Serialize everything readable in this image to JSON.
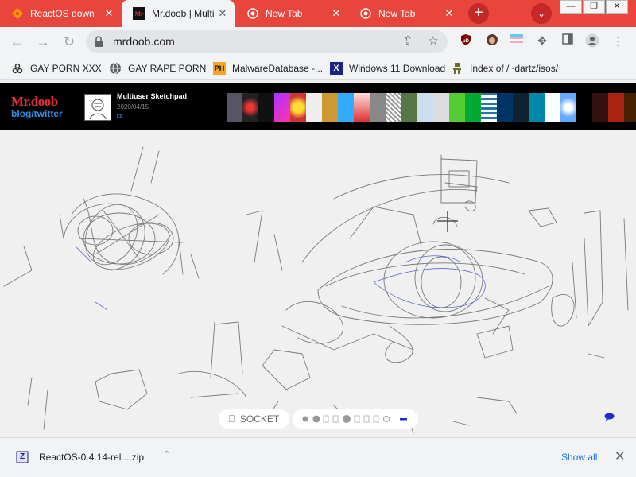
{
  "tabs": [
    {
      "title": "ReactOS down",
      "icon": "reactos-icon"
    },
    {
      "title": "Mr.doob | Multiu",
      "icon": "mrdoob-icon"
    },
    {
      "title": "New Tab",
      "icon": "chrome-icon"
    },
    {
      "title": "New Tab",
      "icon": "chrome-icon"
    }
  ],
  "tab_close": "✕",
  "newtab_symbol": "+",
  "tabsearch_symbol": "⌄",
  "window_controls": [
    "—",
    "❐",
    "✕"
  ],
  "address": {
    "url": "mrdoob.com"
  },
  "bookmarks": [
    {
      "label": "GAY PORN XXX",
      "icon": "webhook-icon"
    },
    {
      "label": "GAY RAPE PORN",
      "icon": "globe-icon"
    },
    {
      "label": "MalwareDatabase -...",
      "icon_text": "PH"
    },
    {
      "label": "Windows 11 Download",
      "icon_text": "X"
    },
    {
      "label": "Index of /~dartz/isos/",
      "icon": "figure-icon"
    }
  ],
  "page": {
    "brand_line1": "Mr.doob",
    "brand_line2": "blog/twitter",
    "project_title": "Multiuser Sketchpad",
    "project_date": "2020/04/15",
    "project_link": "⧉"
  },
  "controls": {
    "socket_icon": "⎕",
    "socket_label": "SOCKET",
    "tools": [
      "●",
      "●",
      "▯",
      "▯",
      "●",
      "▯",
      "▯",
      "▯",
      "▯",
      "○",
      "—"
    ]
  },
  "downloads": {
    "file_label": "ReactOS-0.4.14-rel....zip",
    "file_icon_text": "Z",
    "show_all": "Show all",
    "close": "✕",
    "chevron": "⌃"
  },
  "colors": {
    "tabstrip": "#e8453c",
    "accent_red": "#e0313a",
    "link_blue": "#2c8ee8"
  }
}
